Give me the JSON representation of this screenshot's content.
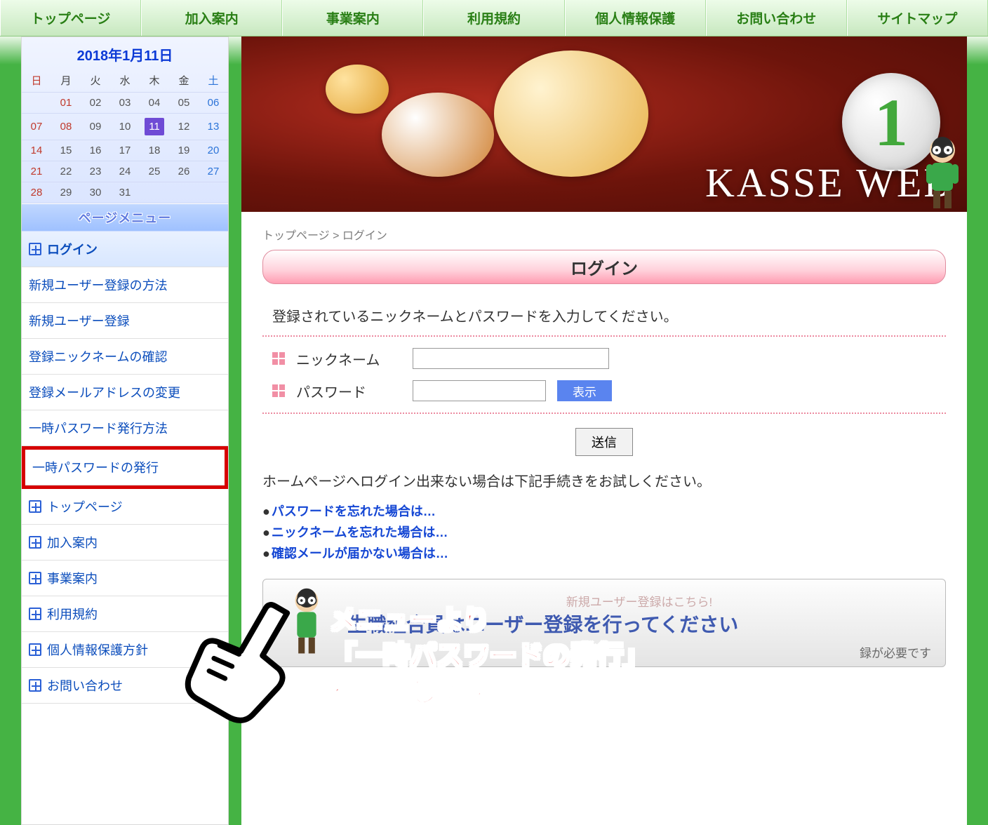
{
  "topnav": [
    "トップページ",
    "加入案内",
    "事業案内",
    "利用規約",
    "個人情報保護",
    "お問い合わせ",
    "サイトマップ"
  ],
  "calendar": {
    "title": "2018年1月11日",
    "dow": [
      "日",
      "月",
      "火",
      "水",
      "木",
      "金",
      "土"
    ],
    "weeks": [
      [
        "",
        "01",
        "02",
        "03",
        "04",
        "05",
        "06"
      ],
      [
        "07",
        "08",
        "09",
        "10",
        "11",
        "12",
        "13"
      ],
      [
        "14",
        "15",
        "16",
        "17",
        "18",
        "19",
        "20"
      ],
      [
        "21",
        "22",
        "23",
        "24",
        "25",
        "26",
        "27"
      ],
      [
        "28",
        "29",
        "30",
        "31",
        "",
        "",
        ""
      ]
    ],
    "today": "11"
  },
  "page_menu_title": "ページメニュー",
  "side_menu": {
    "active": "ログイン",
    "sub": [
      "新規ユーザー登録の方法",
      "新規ユーザー登録",
      "登録ニックネームの確認",
      "登録メールアドレスの変更",
      "一時パスワード発行方法",
      "一時パスワードの発行"
    ],
    "highlighted_index": 5,
    "main": [
      "トップページ",
      "加入案内",
      "事業案内",
      "利用規約",
      "個人情報保護方針",
      "お問い合わせ"
    ]
  },
  "hero": {
    "site_title_a": "KASSE",
    "site_title_b": "WEB",
    "step": "1"
  },
  "breadcrumb": "トップページ > ログイン",
  "login": {
    "title": "ログイン",
    "desc": "登録されているニックネームとパスワードを入力してください。",
    "nickname_label": "ニックネーム",
    "password_label": "パスワード",
    "show_label": "表示",
    "submit_label": "送信"
  },
  "cannot_login_note": "ホームページへログイン出来ない場合は下記手続きをお試しください。",
  "help_links": [
    "パスワードを忘れた場合は…",
    "ニックネームを忘れた場合は…",
    "確認メールが届かない場合は…"
  ],
  "reg_banner": {
    "title_main": "生職組合員はユーザー登録を行ってください",
    "tag": "新規ユーザー登録はこちら!",
    "subnote": "録が必要です"
  },
  "callout": {
    "line1": "メニューより",
    "line2": "「一時パスワードの発行」",
    "line3": "を選択します"
  }
}
